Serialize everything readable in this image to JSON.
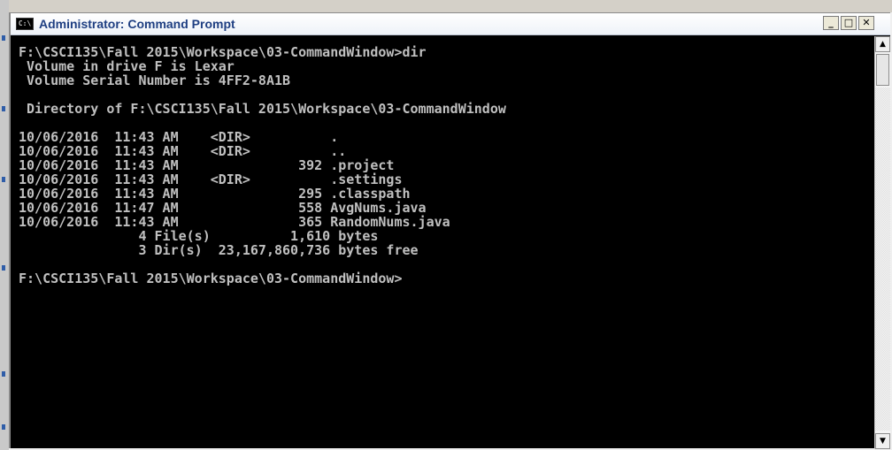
{
  "window": {
    "title": "Administrator: Command Prompt",
    "icon_text": "C:\\",
    "minimize_glyph": "_",
    "maximize_glyph": "□",
    "close_glyph": "✕"
  },
  "scrollbar": {
    "up_glyph": "▲",
    "down_glyph": "▼"
  },
  "console": {
    "lines": [
      "F:\\CSCI135\\Fall 2015\\Workspace\\03-CommandWindow>dir",
      " Volume in drive F is Lexar",
      " Volume Serial Number is 4FF2-8A1B",
      "",
      " Directory of F:\\CSCI135\\Fall 2015\\Workspace\\03-CommandWindow",
      "",
      "10/06/2016  11:43 AM    <DIR>          .",
      "10/06/2016  11:43 AM    <DIR>          ..",
      "10/06/2016  11:43 AM               392 .project",
      "10/06/2016  11:43 AM    <DIR>          .settings",
      "10/06/2016  11:43 AM               295 .classpath",
      "10/06/2016  11:47 AM               558 AvgNums.java",
      "10/06/2016  11:43 AM               365 RandomNums.java",
      "               4 File(s)          1,610 bytes",
      "               3 Dir(s)  23,167,860,736 bytes free",
      "",
      "F:\\CSCI135\\Fall 2015\\Workspace\\03-CommandWindow>"
    ]
  }
}
